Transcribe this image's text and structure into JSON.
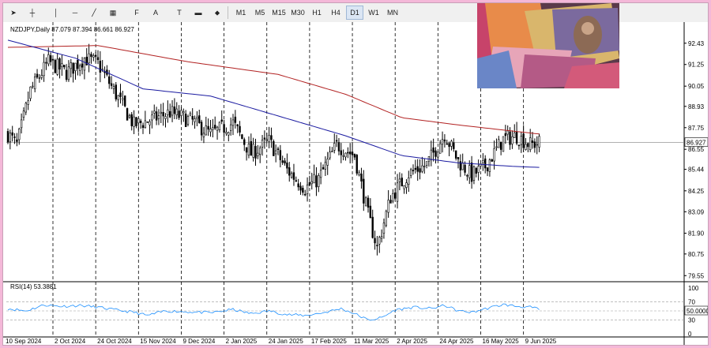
{
  "toolbar": {
    "timeframes": [
      "M1",
      "M5",
      "M15",
      "M30",
      "H1",
      "H4",
      "D1",
      "W1",
      "MN"
    ],
    "selected_timeframe": "D1",
    "tools": [
      {
        "icon": "cursor-arrow-icon",
        "glyph": "➤"
      },
      {
        "icon": "crosshair-icon",
        "glyph": "┼"
      },
      {
        "icon": "vertical-line-icon",
        "glyph": "│"
      },
      {
        "icon": "horizontal-line-icon",
        "glyph": "─"
      },
      {
        "icon": "trendline-icon",
        "glyph": "╱"
      },
      {
        "icon": "channel-icon",
        "glyph": "▦"
      },
      {
        "icon": "fibonacci-icon",
        "glyph": "F"
      },
      {
        "icon": "text-icon",
        "glyph": "A"
      },
      {
        "icon": "label-icon",
        "glyph": "T"
      },
      {
        "icon": "rectangle-icon",
        "glyph": "▬"
      },
      {
        "icon": "shapes-icon",
        "glyph": "⬥"
      }
    ]
  },
  "symbol_header": "NZDJPY,Daily  87.079 87.394 86.661 86.927",
  "rsi_header": "RSI(14) 53.3881",
  "current_price_label": "86.927",
  "rsi_current_label": "50.0000",
  "colors": {
    "candle": "#000000",
    "ma_fast": "#1a1aa0",
    "ma_slow": "#b22222",
    "rsi": "#1e90ff",
    "grid": "#000000",
    "price_line": "#808080",
    "accent_bg": "#f4b8d8"
  },
  "chart_data": [
    {
      "type": "candlestick",
      "symbol": "NZDJPY",
      "timeframe": "Daily",
      "x_labels": [
        "10 Sep 2024",
        "2 Oct 2024",
        "24 Oct 2024",
        "15 Nov 2024",
        "9 Dec 2024",
        "2 Jan 2025",
        "24 Jan 2025",
        "17 Feb 2025",
        "11 Mar 2025",
        "2 Apr 2025",
        "24 Apr 2025",
        "16 May 2025",
        "9 Jun 2025"
      ],
      "y_ticks": [
        92.43,
        91.25,
        90.05,
        88.93,
        87.75,
        86.55,
        85.44,
        84.25,
        83.09,
        81.9,
        80.75,
        79.55
      ],
      "ylim": [
        79.3,
        93.25
      ],
      "close_anchors": [
        [
          0,
          87.4
        ],
        [
          4,
          86.8
        ],
        [
          10,
          89.8
        ],
        [
          18,
          91.4
        ],
        [
          26,
          90.8
        ],
        [
          34,
          91.6
        ],
        [
          40,
          91.3
        ],
        [
          48,
          89.6
        ],
        [
          56,
          87.9
        ],
        [
          64,
          88.2
        ],
        [
          72,
          88.6
        ],
        [
          82,
          88.1
        ],
        [
          90,
          87.4
        ],
        [
          100,
          88.0
        ],
        [
          108,
          86.3
        ],
        [
          116,
          87.0
        ],
        [
          124,
          85.4
        ],
        [
          132,
          84.4
        ],
        [
          138,
          84.9
        ],
        [
          146,
          86.8
        ],
        [
          154,
          86.2
        ],
        [
          160,
          82.9
        ],
        [
          164,
          81.1
        ],
        [
          170,
          83.9
        ],
        [
          178,
          85.2
        ],
        [
          186,
          85.7
        ],
        [
          194,
          87.4
        ],
        [
          200,
          85.9
        ],
        [
          206,
          85.1
        ],
        [
          212,
          85.6
        ],
        [
          220,
          87.1
        ],
        [
          226,
          87.3
        ],
        [
          232,
          86.8
        ],
        [
          236,
          86.93
        ]
      ],
      "ma_fast_anchors": [
        [
          0,
          92.6
        ],
        [
          30,
          91.6
        ],
        [
          60,
          89.9
        ],
        [
          90,
          89.5
        ],
        [
          120,
          88.4
        ],
        [
          150,
          87.3
        ],
        [
          175,
          86.2
        ],
        [
          200,
          85.8
        ],
        [
          225,
          85.6
        ],
        [
          236,
          85.55
        ]
      ],
      "ma_slow_anchors": [
        [
          0,
          92.2
        ],
        [
          40,
          92.3
        ],
        [
          80,
          91.4
        ],
        [
          120,
          90.7
        ],
        [
          150,
          89.6
        ],
        [
          175,
          88.3
        ],
        [
          200,
          87.9
        ],
        [
          225,
          87.55
        ],
        [
          236,
          87.4
        ]
      ],
      "current_price": 86.927
    },
    {
      "type": "line",
      "name": "RSI(14)",
      "value": 53.3881,
      "y_ticks": [
        100,
        70,
        50,
        30,
        0
      ],
      "ylim": [
        0,
        100
      ],
      "levels": [
        70,
        30
      ],
      "anchors": [
        [
          0,
          55
        ],
        [
          8,
          50
        ],
        [
          16,
          63
        ],
        [
          24,
          60
        ],
        [
          32,
          62
        ],
        [
          40,
          58
        ],
        [
          48,
          52
        ],
        [
          56,
          47
        ],
        [
          62,
          40
        ],
        [
          70,
          50
        ],
        [
          80,
          48
        ],
        [
          90,
          46
        ],
        [
          100,
          53
        ],
        [
          108,
          44
        ],
        [
          116,
          50
        ],
        [
          124,
          42
        ],
        [
          132,
          40
        ],
        [
          140,
          46
        ],
        [
          148,
          55
        ],
        [
          154,
          44
        ],
        [
          160,
          30
        ],
        [
          166,
          35
        ],
        [
          172,
          52
        ],
        [
          180,
          58
        ],
        [
          188,
          55
        ],
        [
          194,
          62
        ],
        [
          200,
          50
        ],
        [
          206,
          47
        ],
        [
          214,
          57
        ],
        [
          220,
          64
        ],
        [
          226,
          60
        ],
        [
          232,
          58
        ],
        [
          236,
          53.4
        ]
      ]
    }
  ]
}
